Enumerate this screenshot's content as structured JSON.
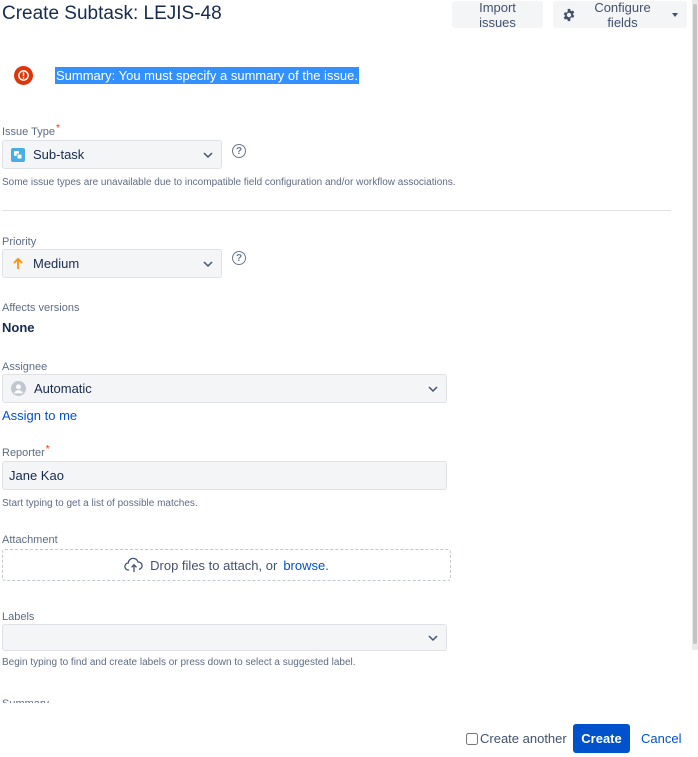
{
  "header": {
    "title": "Create Subtask: LEJIS-48",
    "import_label": "Import issues",
    "configure_label": "Configure fields"
  },
  "error": {
    "message": "Summary: You must specify a summary of the issue."
  },
  "issue_type": {
    "label": "Issue Type",
    "required": "*",
    "value": "Sub-task",
    "hint": "Some issue types are unavailable due to incompatible field configuration and/or workflow associations."
  },
  "priority": {
    "label": "Priority",
    "value": "Medium"
  },
  "affects_versions": {
    "label": "Affects versions",
    "value": "None"
  },
  "assignee": {
    "label": "Assignee",
    "value": "Automatic",
    "assign_to_me": "Assign to me"
  },
  "reporter": {
    "label": "Reporter",
    "required": "*",
    "value": "Jane Kao",
    "hint": "Start typing to get a list of possible matches."
  },
  "attachment": {
    "label": "Attachment",
    "drop_text": "Drop files to attach, or",
    "browse_label": "browse."
  },
  "labels": {
    "label": "Labels",
    "value": "",
    "hint": "Begin typing to find and create labels or press down to select a suggested label."
  },
  "summary": {
    "label": "Summary"
  },
  "footer": {
    "create_another_label": "Create another",
    "create_label": "Create",
    "cancel_label": "Cancel"
  },
  "icons": {
    "config": "gear-icon",
    "error": "error-icon",
    "subtask": "subtask-icon",
    "priority": "arrow-up-icon",
    "help": "question-circle-icon",
    "avatar": "user-avatar-icon",
    "upload": "cloud-upload-icon",
    "dropdown": "chevron-down-icon"
  },
  "colors": {
    "primary": "#0052cc",
    "error": "#de350b",
    "priority_medium": "#ff8b00",
    "selection": "#3390ff"
  }
}
